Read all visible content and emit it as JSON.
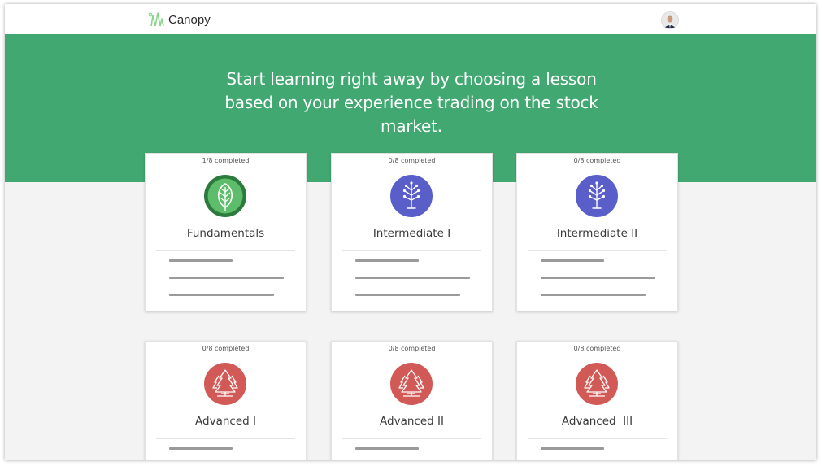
{
  "app": {
    "name": "Canopy",
    "brand_color": "#8bd48d"
  },
  "hero": {
    "text": "Start learning right away by choosing a lesson based on your experience trading on the stock market.",
    "background": "#42a872"
  },
  "lessons": [
    {
      "progress": "1/8 completed",
      "title": "Fundamentals",
      "icon": "leaf-icon",
      "color": "#5dbd6a",
      "completed": 1,
      "total": 8
    },
    {
      "progress": "0/8 completed",
      "title": "Intermediate I",
      "icon": "sprig-icon",
      "color": "#5a5ec9",
      "completed": 0,
      "total": 8
    },
    {
      "progress": "0/8 completed",
      "title": "Intermediate II",
      "icon": "sprig-icon",
      "color": "#5a5ec9",
      "completed": 0,
      "total": 8
    },
    {
      "progress": "0/8 completed",
      "title": "Advanced I",
      "icon": "pine-trees-icon",
      "color": "#d25a56",
      "completed": 0,
      "total": 8
    },
    {
      "progress": "0/8 completed",
      "title": "Advanced II",
      "icon": "pine-trees-icon",
      "color": "#d25a56",
      "completed": 0,
      "total": 8
    },
    {
      "progress": "0/8 completed",
      "title": "Advanced  III",
      "icon": "pine-trees-icon",
      "color": "#d25a56",
      "completed": 0,
      "total": 8
    }
  ]
}
